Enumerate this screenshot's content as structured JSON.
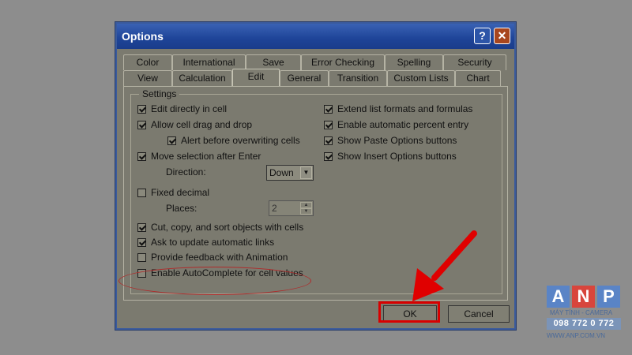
{
  "dialog": {
    "title": "Options",
    "help_label": "?",
    "close_label": "✕",
    "tabs_row1": [
      "Color",
      "International",
      "Save",
      "Error Checking",
      "Spelling",
      "Security"
    ],
    "tabs_row2": [
      "View",
      "Calculation",
      "Edit",
      "General",
      "Transition",
      "Custom Lists",
      "Chart"
    ],
    "active_tab": "Edit",
    "group_label": "Settings",
    "left_options": [
      {
        "label": "Edit directly in cell",
        "checked": true
      },
      {
        "label": "Allow cell drag and drop",
        "checked": true
      },
      {
        "label": "Alert before overwriting cells",
        "checked": true
      },
      {
        "label": "Move selection after Enter",
        "checked": true
      },
      {
        "label": "Fixed decimal",
        "checked": false
      },
      {
        "label": "Cut, copy, and sort objects with cells",
        "checked": true
      },
      {
        "label": "Ask to update automatic links",
        "checked": true
      },
      {
        "label": "Provide feedback with Animation",
        "checked": false
      },
      {
        "label": "Enable AutoComplete for cell values",
        "checked": false
      }
    ],
    "right_options": [
      {
        "label": "Extend list formats and formulas",
        "checked": true
      },
      {
        "label": "Enable automatic percent entry",
        "checked": true
      },
      {
        "label": "Show Paste Options buttons",
        "checked": true
      },
      {
        "label": "Show Insert Options buttons",
        "checked": true
      }
    ],
    "direction_label": "Direction:",
    "direction_value": "Down",
    "places_label": "Places:",
    "places_value": "2",
    "ok_label": "OK",
    "cancel_label": "Cancel"
  },
  "logo": {
    "letters": [
      "A",
      "N",
      "P"
    ],
    "letter_colors": [
      "#5a84c6",
      "#d8453c",
      "#5a84c6"
    ],
    "tagline": "MÁY TÍNH - CAMERA",
    "phone": "098 772 0 772",
    "website": "WWW.ANP.COM.VN"
  },
  "annotation_colors": {
    "highlight": "#d80000",
    "arrow": "#e00000"
  }
}
